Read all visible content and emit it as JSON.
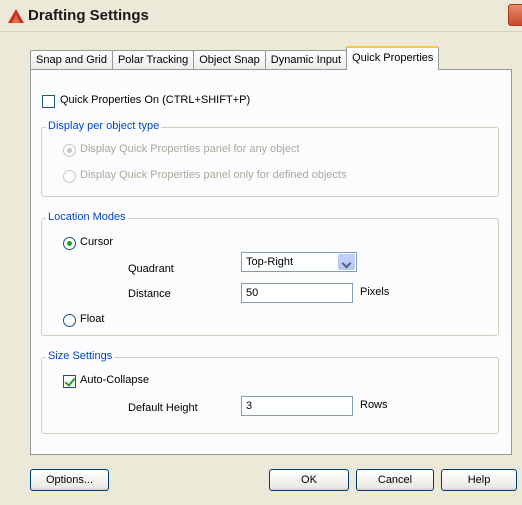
{
  "window": {
    "title": "Drafting Settings"
  },
  "tabs": [
    {
      "label": "Snap and Grid"
    },
    {
      "label": "Polar Tracking"
    },
    {
      "label": "Object Snap"
    },
    {
      "label": "Dynamic Input"
    },
    {
      "label": "Quick Properties",
      "active": true
    }
  ],
  "quick_properties_on": {
    "label": "Quick Properties On (CTRL+SHIFT+P)",
    "checked": false
  },
  "display_per_object": {
    "title": "Display per object type",
    "options": [
      {
        "label": "Display Quick Properties panel for any object",
        "selected": true,
        "enabled": false
      },
      {
        "label": "Display Quick Properties panel only for defined objects",
        "selected": false,
        "enabled": false
      }
    ]
  },
  "location_modes": {
    "title": "Location Modes",
    "cursor_label": "Cursor",
    "cursor_selected": true,
    "quadrant_label": "Quadrant",
    "quadrant_value": "Top-Right",
    "distance_label": "Distance",
    "distance_value": "50",
    "distance_unit": "Pixels",
    "float_label": "Float",
    "float_selected": false
  },
  "size_settings": {
    "title": "Size Settings",
    "auto_collapse_label": "Auto-Collapse",
    "auto_collapse_checked": true,
    "default_height_label": "Default Height",
    "default_height_value": "3",
    "default_height_unit": "Rows"
  },
  "buttons": {
    "options": "Options...",
    "ok": "OK",
    "cancel": "Cancel",
    "help": "Help"
  },
  "colors": {
    "group_title": "#0046d5",
    "active_tab_highlight": "#ffc83c",
    "check_mark": "#21a121"
  }
}
